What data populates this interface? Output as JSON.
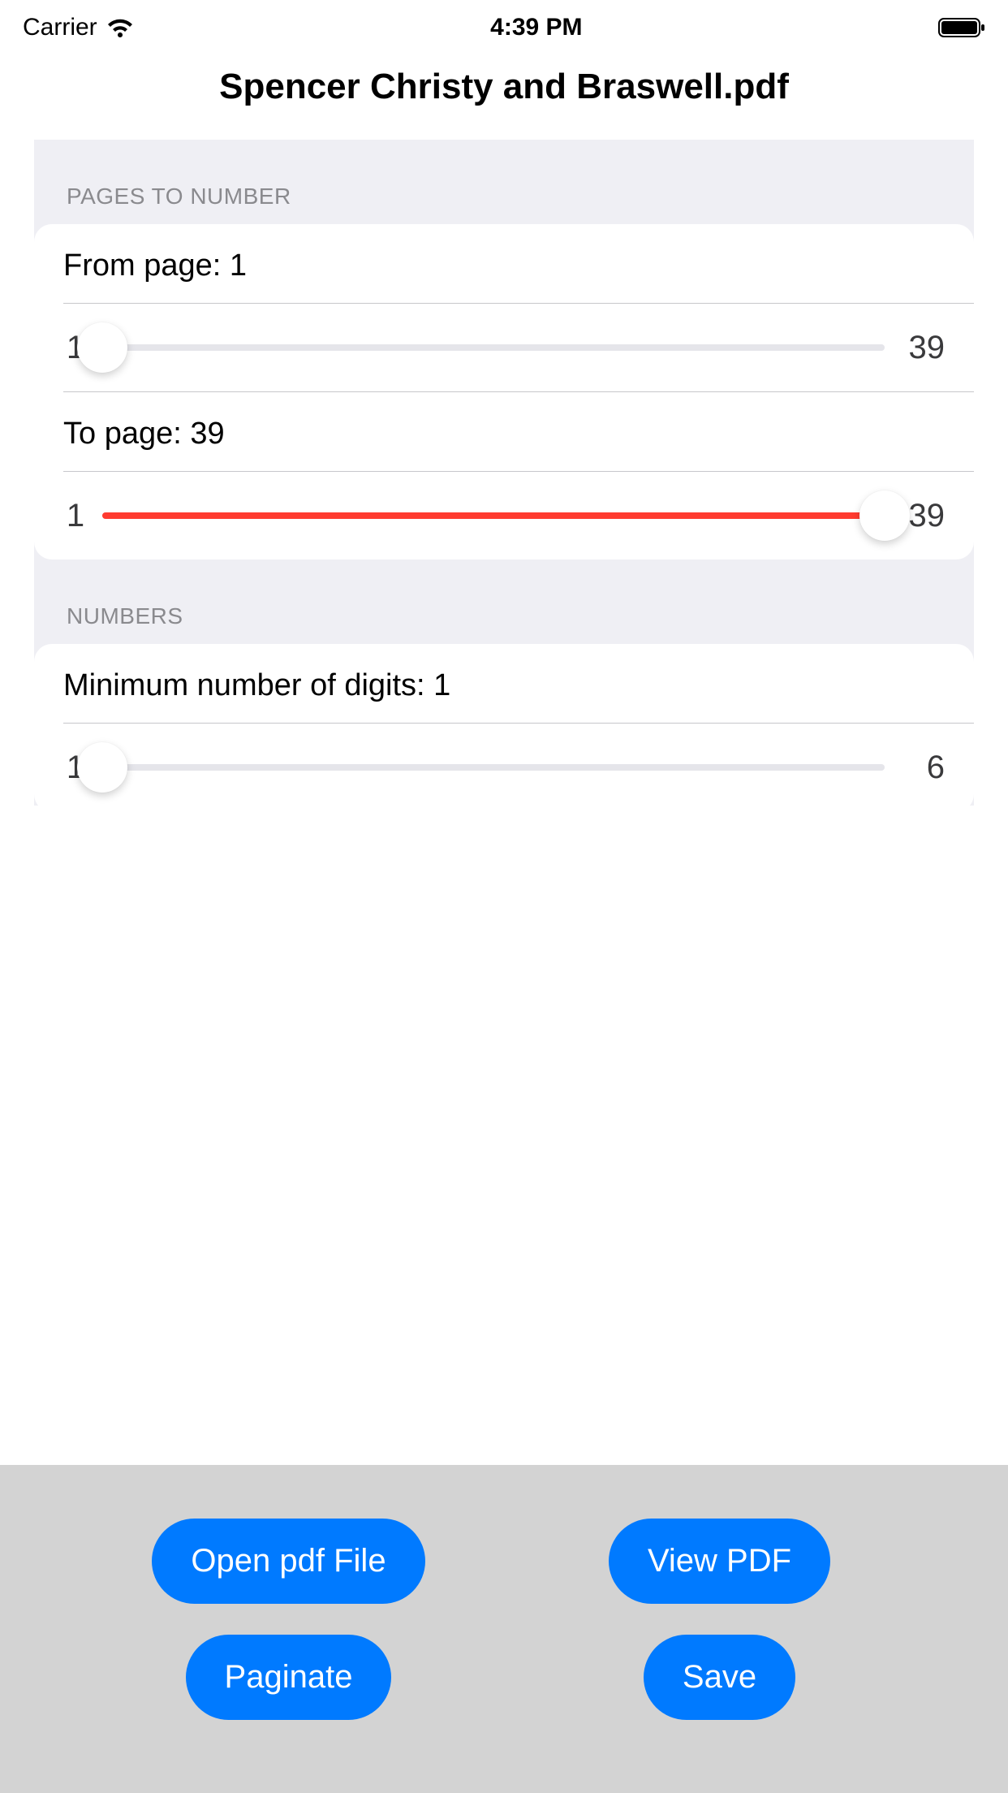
{
  "status": {
    "carrier": "Carrier",
    "time": "4:39 PM"
  },
  "title": "Spencer Christy and Braswell.pdf",
  "sections": {
    "pages": {
      "header": "Pages to number",
      "from": {
        "label_prefix": "From page: ",
        "value": 1,
        "min": 1,
        "max": 39,
        "min_label": "1",
        "max_label": "39"
      },
      "to": {
        "label_prefix": "To page: ",
        "value": 39,
        "min": 1,
        "max": 39,
        "min_label": "1",
        "max_label": "39"
      }
    },
    "numbers": {
      "header": "Numbers",
      "digits": {
        "label_prefix": "Minimum number of digits: ",
        "value": 1,
        "min": 1,
        "max": 6,
        "min_label": "1",
        "max_label": "6"
      }
    }
  },
  "toolbar": {
    "open": "Open pdf File",
    "view": "View PDF",
    "paginate": "Paginate",
    "save": "Save"
  },
  "colors": {
    "accent": "#007aff",
    "slider_fill": "#ff3b30",
    "track": "#e5e5ea"
  }
}
